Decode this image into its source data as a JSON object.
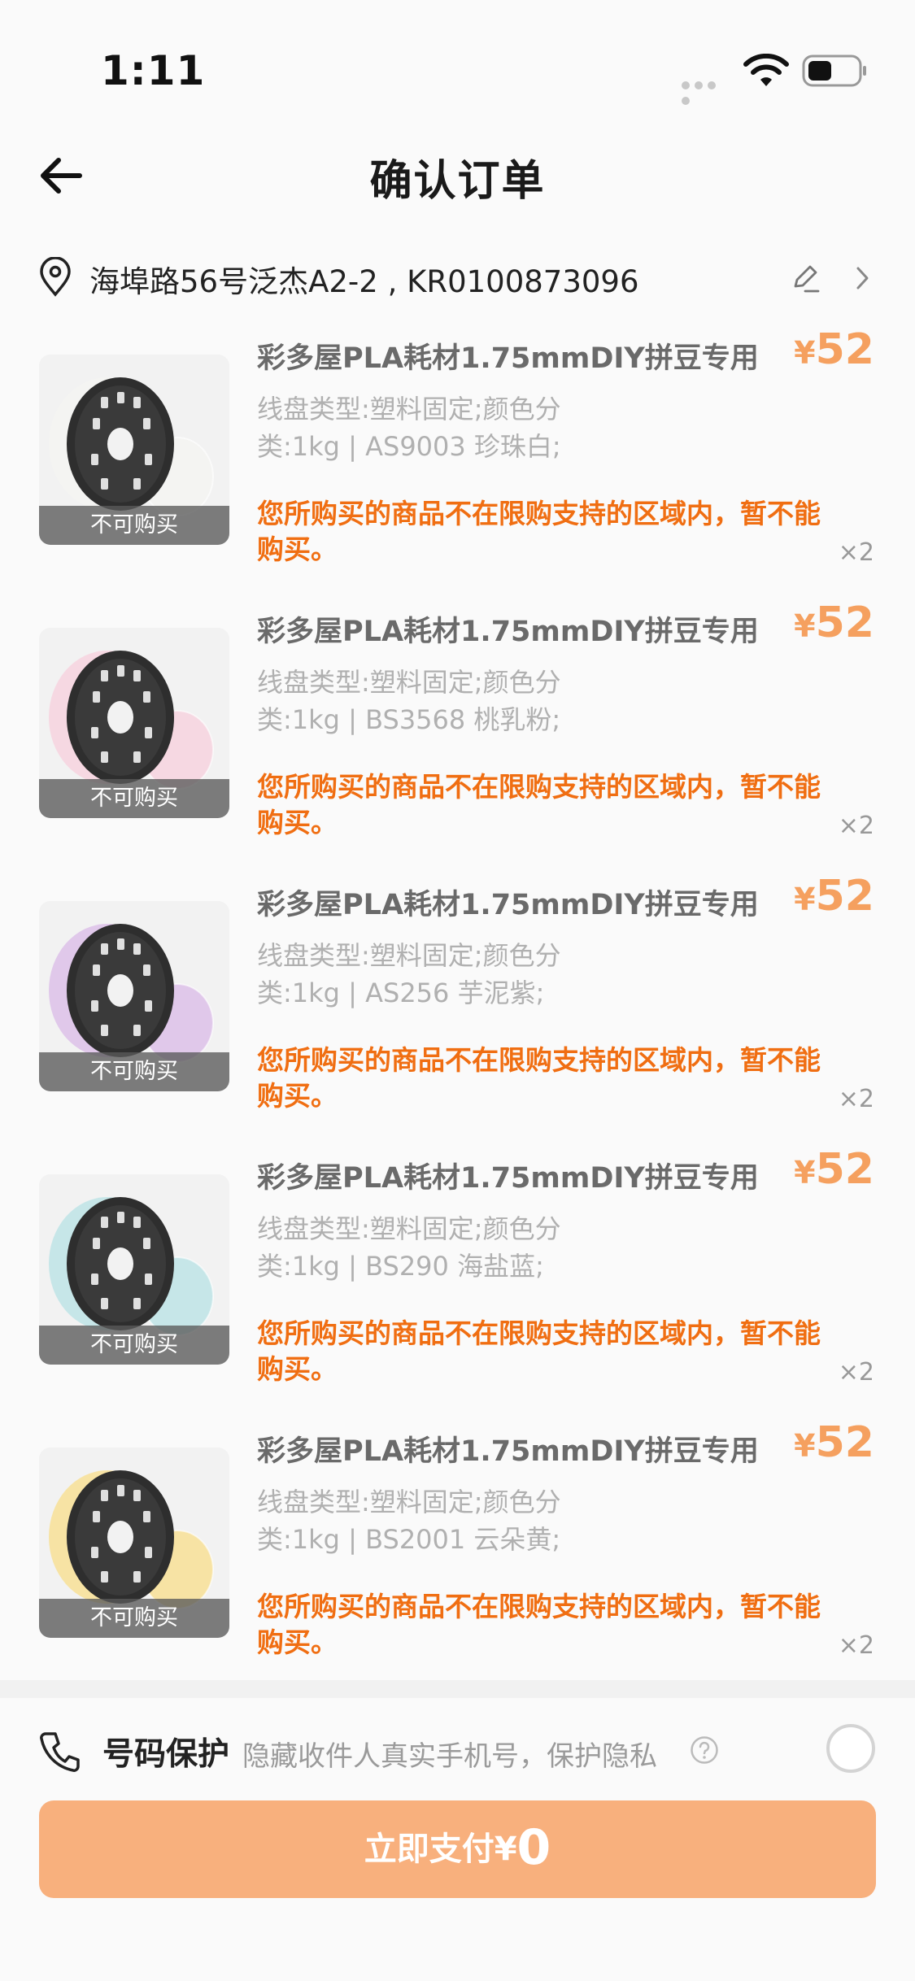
{
  "status_bar": {
    "time": "1:11"
  },
  "header": {
    "title": "确认订单"
  },
  "address": {
    "text": "海埠路56号泛杰A2-2 , KR0100873096"
  },
  "products": [
    {
      "title": "彩多屋PLA耗材1.75mmDIY拼豆专用",
      "currency": "¥",
      "price": "52",
      "spec": "线盘类型:塑料固定;颜色分类:1kg | AS9003 珍珠白;",
      "warning": "您所购买的商品不在限购支持的区域内，暂不能购买。",
      "quantity": "×2",
      "badge": "不可购买",
      "color": "#f4f4f2"
    },
    {
      "title": "彩多屋PLA耗材1.75mmDIY拼豆专用",
      "currency": "¥",
      "price": "52",
      "spec": "线盘类型:塑料固定;颜色分类:1kg | BS3568 桃乳粉;",
      "warning": "您所购买的商品不在限购支持的区域内，暂不能购买。",
      "quantity": "×2",
      "badge": "不可购买",
      "color": "#f6d8e2"
    },
    {
      "title": "彩多屋PLA耗材1.75mmDIY拼豆专用",
      "currency": "¥",
      "price": "52",
      "spec": "线盘类型:塑料固定;颜色分类:1kg | AS256 芋泥紫;",
      "warning": "您所购买的商品不在限购支持的区域内，暂不能购买。",
      "quantity": "×2",
      "badge": "不可购买",
      "color": "#e0c8ea"
    },
    {
      "title": "彩多屋PLA耗材1.75mmDIY拼豆专用",
      "currency": "¥",
      "price": "52",
      "spec": "线盘类型:塑料固定;颜色分类:1kg | BS290 海盐蓝;",
      "warning": "您所购买的商品不在限购支持的区域内，暂不能购买。",
      "quantity": "×2",
      "badge": "不可购买",
      "color": "#c6e6e8"
    },
    {
      "title": "彩多屋PLA耗材1.75mmDIY拼豆专用",
      "currency": "¥",
      "price": "52",
      "spec": "线盘类型:塑料固定;颜色分类:1kg | BS2001 云朵黄;",
      "warning": "您所购买的商品不在限购支持的区域内，暂不能购买。",
      "quantity": "×2",
      "badge": "不可购买",
      "color": "#f7e3a4"
    }
  ],
  "protection": {
    "title": "号码保护",
    "description": "隐藏收件人真实手机号，保护隐私"
  },
  "pay": {
    "label": "立即支付¥",
    "amount": "0"
  },
  "colors": {
    "accent": "#f5a05f",
    "warning": "#f06e12",
    "pay_button": "#f8b07d"
  }
}
